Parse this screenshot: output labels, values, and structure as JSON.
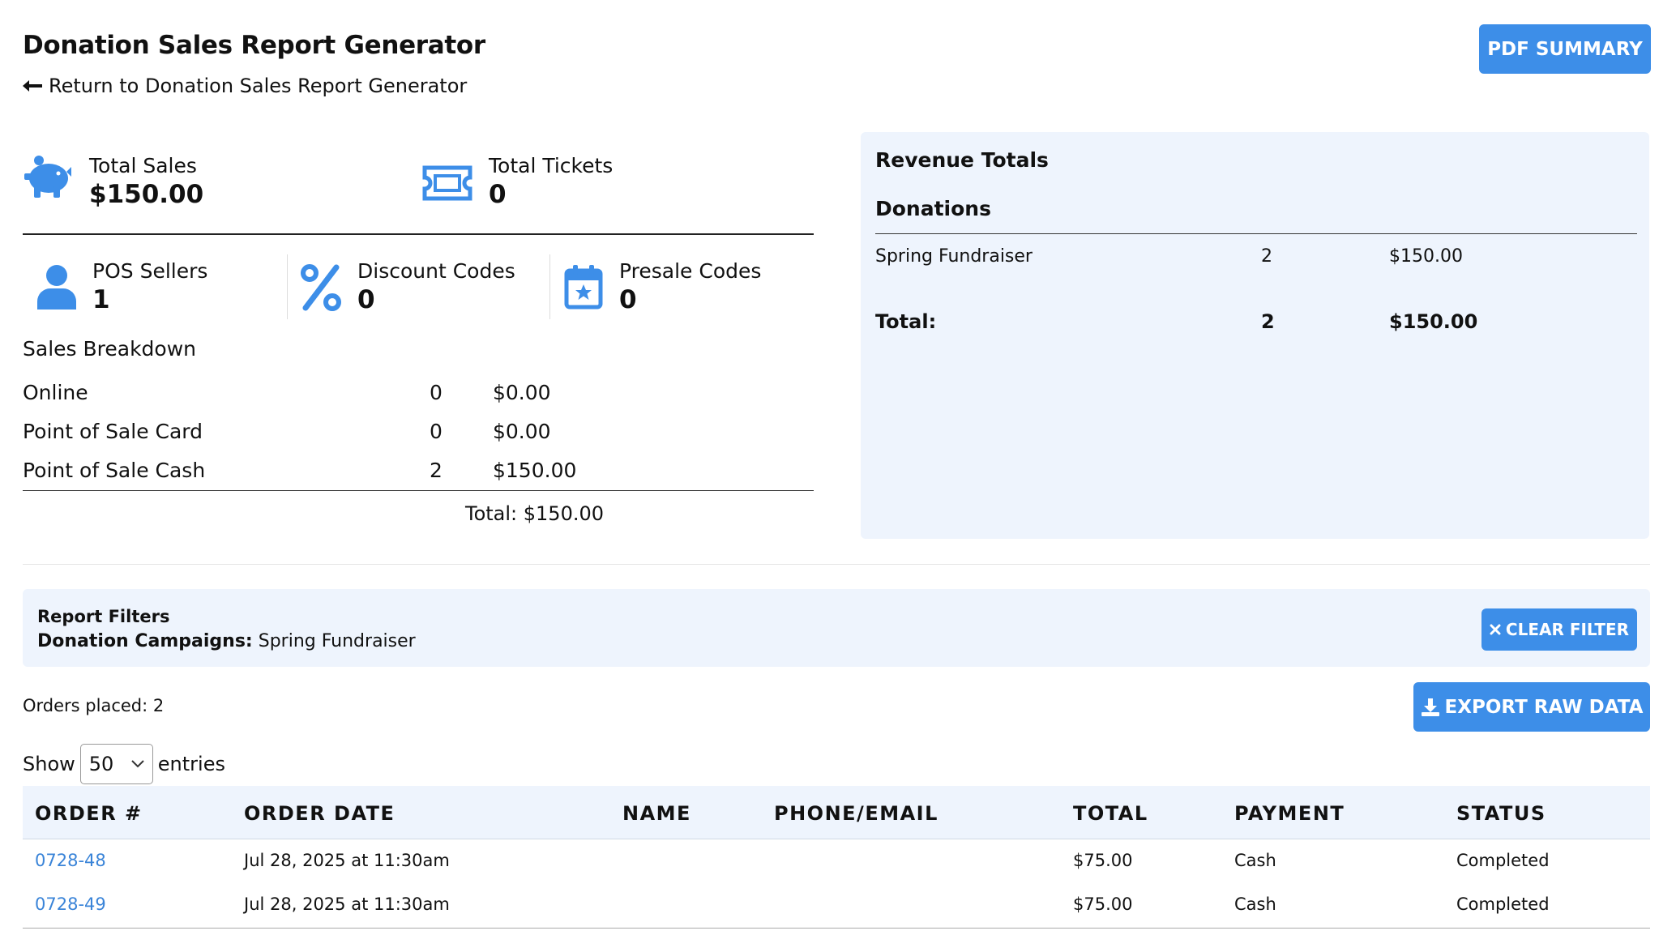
{
  "header": {
    "title": "Donation Sales Report Generator",
    "back_link": "Return to Donation Sales Report Generator",
    "pdf_button": "PDF SUMMARY"
  },
  "stats": {
    "total_sales": {
      "label": "Total Sales",
      "value": "$150.00",
      "icon": "piggy-bank-icon"
    },
    "total_tickets": {
      "label": "Total Tickets",
      "value": "0",
      "icon": "ticket-icon"
    },
    "pos_sellers": {
      "label": "POS Sellers",
      "value": "1",
      "icon": "user-icon"
    },
    "discount_codes": {
      "label": "Discount Codes",
      "value": "0",
      "icon": "percent-icon"
    },
    "presale_codes": {
      "label": "Presale Codes",
      "value": "0",
      "icon": "calendar-star-icon"
    }
  },
  "sales_breakdown": {
    "title": "Sales Breakdown",
    "rows": [
      {
        "label": "Online",
        "count": "0",
        "amount": "$0.00"
      },
      {
        "label": "Point of Sale Card",
        "count": "0",
        "amount": "$0.00"
      },
      {
        "label": "Point of Sale Cash",
        "count": "2",
        "amount": "$150.00"
      }
    ],
    "total": "Total: $150.00"
  },
  "revenue": {
    "title": "Revenue Totals",
    "section": "Donations",
    "rows": [
      {
        "label": "Spring Fundraiser",
        "count": "2",
        "amount": "$150.00"
      }
    ],
    "total": {
      "label": "Total:",
      "count": "2",
      "amount": "$150.00"
    }
  },
  "filters": {
    "title": "Report Filters",
    "label": "Donation Campaigns:",
    "value": "Spring Fundraiser",
    "clear_button": "CLEAR FILTER"
  },
  "orders_placed": "Orders placed: 2",
  "export_button": "EXPORT RAW DATA",
  "table": {
    "show_label": "Show",
    "entries_label": "entries",
    "page_size": "50",
    "columns": [
      "ORDER #",
      "ORDER DATE",
      "NAME",
      "PHONE/EMAIL",
      "TOTAL",
      "PAYMENT",
      "STATUS"
    ],
    "rows": [
      {
        "order": "0728-48",
        "date": "Jul 28, 2025 at 11:30am",
        "name": "",
        "contact": "",
        "total": "$75.00",
        "payment": "Cash",
        "status": "Completed"
      },
      {
        "order": "0728-49",
        "date": "Jul 28, 2025 at 11:30am",
        "name": "",
        "contact": "",
        "total": "$75.00",
        "payment": "Cash",
        "status": "Completed"
      }
    ]
  },
  "colors": {
    "accent": "#3d8ee8",
    "panel": "#eef4fd",
    "link": "#3a84d8"
  }
}
